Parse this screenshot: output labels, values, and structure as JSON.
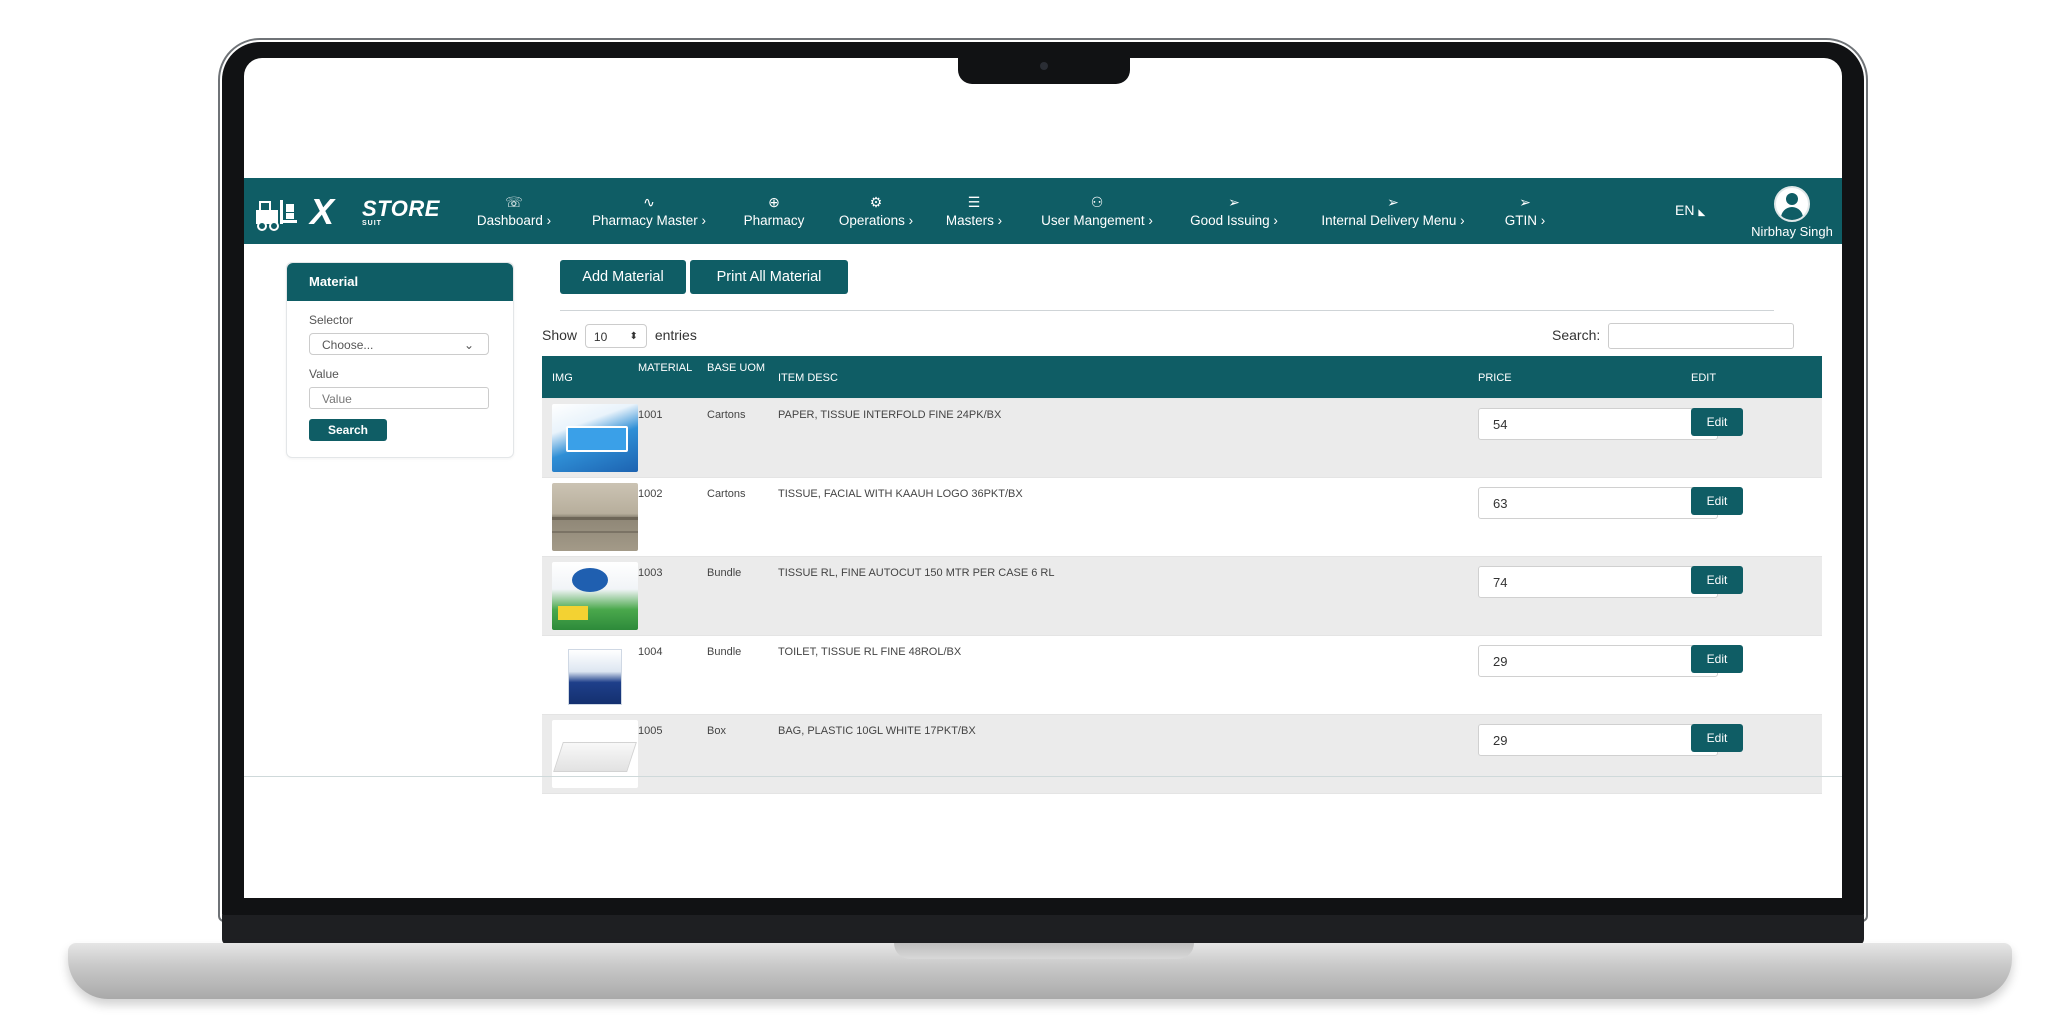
{
  "brand": {
    "name": "STORE",
    "subtitle": "SUIT"
  },
  "nav": {
    "items": [
      {
        "label": "Dashboard",
        "icon": "phone-icon"
      },
      {
        "label": "Pharmacy Master",
        "icon": "pulse-icon"
      },
      {
        "label": "Pharmacy",
        "icon": "target-icon"
      },
      {
        "label": "Operations",
        "icon": "gear-icon"
      },
      {
        "label": "Masters",
        "icon": "server-icon"
      },
      {
        "label": "User Mangement",
        "icon": "user-icon"
      },
      {
        "label": "Good Issuing",
        "icon": "send-icon"
      },
      {
        "label": "Internal Delivery Menu",
        "icon": "send-icon"
      },
      {
        "label": "GTIN",
        "icon": "send-icon"
      }
    ],
    "chevron": "›",
    "language": "EN",
    "user_name": "Nirbhay Singh"
  },
  "filter_panel": {
    "title": "Material",
    "selector_label": "Selector",
    "selector_value": "Choose...",
    "value_label": "Value",
    "value_placeholder": "Value",
    "search_button": "Search"
  },
  "toolbar": {
    "add_material": "Add Material",
    "print_all": "Print All Material"
  },
  "table_controls": {
    "show_label": "Show",
    "entries_value": "10",
    "entries_label": "entries",
    "search_label": "Search:"
  },
  "table": {
    "headers": [
      "IMG",
      "MATERIAL",
      "BASE UOM",
      "ITEM DESC",
      "PRICE",
      "EDIT"
    ],
    "rows": [
      {
        "material": "1001",
        "uom": "Cartons",
        "desc": "PAPER, TISSUE INTERFOLD FINE 24PK/BX",
        "price": "54",
        "edit": "Edit"
      },
      {
        "material": "1002",
        "uom": "Cartons",
        "desc": "TISSUE, FACIAL WITH KAAUH LOGO 36PKT/BX",
        "price": "63",
        "edit": "Edit"
      },
      {
        "material": "1003",
        "uom": "Bundle",
        "desc": "TISSUE RL, FINE AUTOCUT 150 MTR PER CASE 6 RL",
        "price": "74",
        "edit": "Edit"
      },
      {
        "material": "1004",
        "uom": "Bundle",
        "desc": "TOILET, TISSUE RL FINE 48ROL/BX",
        "price": "29",
        "edit": "Edit"
      },
      {
        "material": "1005",
        "uom": "Box",
        "desc": "BAG, PLASTIC 10GL WHITE 17PKT/BX",
        "price": "29",
        "edit": "Edit"
      }
    ]
  },
  "colors": {
    "primary": "#0f5d65",
    "row_alt": "#ebebeb"
  }
}
